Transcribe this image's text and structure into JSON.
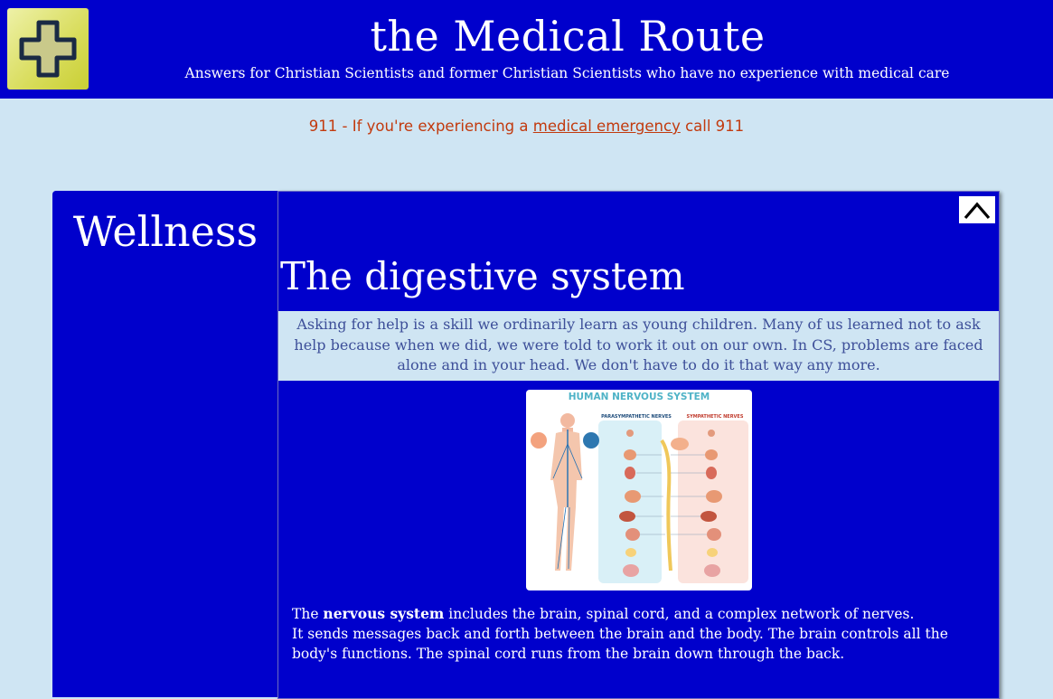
{
  "header": {
    "title": "the Medical Route",
    "subtitle": "Answers for Christian Scientists and former Christian Scientists who have no experience with medical care",
    "logo_icon": "medical-cross-icon"
  },
  "emergency": {
    "prefix": "911 - If you're experiencing a ",
    "link_text": "medical emergency",
    "suffix": " call 911"
  },
  "sidebar": {
    "title": "Wellness"
  },
  "content": {
    "top_button_icon": "chevron-up-icon",
    "section_title": "The digestive system",
    "quote": "Asking for help is a skill we ordinarily learn as young children. Many of us learned not to ask help because when we did, we were told to work it out on our own. In CS, problems are faced alone and in your head. We don't  have to do it that way any more.",
    "figure": {
      "title": "HUMAN NERVOUS SYSTEM",
      "label_left": "PARASYMPATHETIC NERVES",
      "label_right": "SYMPATHETIC NERVES"
    },
    "body": {
      "p1_prefix": "The ",
      "p1_bold": "nervous system",
      "p1_suffix": " includes the brain, spinal cord, and a complex network of nerves.",
      "p2": "It sends messages back and forth between the brain and the body. The brain controls all the body's functions. The spinal cord runs from the brain down through the back."
    }
  },
  "colors": {
    "header_bg": "#0000cc",
    "page_bg": "#cfe5f3",
    "emergency_text": "#c23a0e",
    "quote_text": "#3d4f99"
  }
}
